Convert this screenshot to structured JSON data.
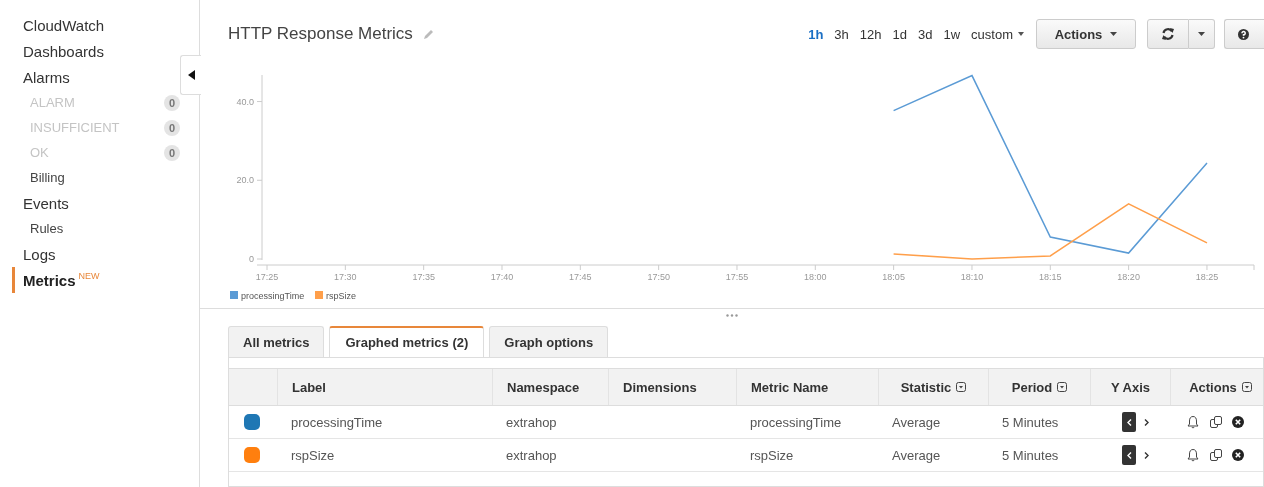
{
  "sidebar": {
    "items": [
      {
        "label": "CloudWatch",
        "selected": false
      },
      {
        "label": "Dashboards",
        "selected": false
      },
      {
        "label": "Alarms",
        "selected": false,
        "children": [
          {
            "label": "ALARM",
            "disabled": true,
            "count": "0"
          },
          {
            "label": "INSUFFICIENT",
            "disabled": true,
            "count": "0"
          },
          {
            "label": "OK",
            "disabled": true,
            "count": "0"
          },
          {
            "label": "Billing",
            "disabled": false
          }
        ]
      },
      {
        "label": "Events",
        "selected": false,
        "children": [
          {
            "label": "Rules",
            "disabled": false
          }
        ]
      },
      {
        "label": "Logs",
        "selected": false
      },
      {
        "label": "Metrics",
        "selected": true,
        "badge": "NEW"
      }
    ]
  },
  "header": {
    "title": "HTTP Response Metrics",
    "ranges": [
      {
        "label": "1h",
        "selected": true
      },
      {
        "label": "3h",
        "selected": false
      },
      {
        "label": "12h",
        "selected": false
      },
      {
        "label": "1d",
        "selected": false
      },
      {
        "label": "3d",
        "selected": false
      },
      {
        "label": "1w",
        "selected": false
      },
      {
        "label": "custom",
        "selected": false
      }
    ],
    "actions_button": "Actions"
  },
  "chart": {
    "chart_data": {
      "type": "line",
      "x": [
        "17:25",
        "17:30",
        "17:35",
        "17:40",
        "17:45",
        "17:50",
        "17:55",
        "18:00",
        "18:05",
        "18:10",
        "18:15",
        "18:20",
        "18:25"
      ],
      "ylim": [
        0,
        47
      ],
      "legend": "bottom",
      "yticks": [
        {
          "value": 0,
          "label": "0"
        },
        {
          "value": 20,
          "label": "20.0"
        },
        {
          "value": 40,
          "label": "40.0"
        }
      ],
      "series": [
        {
          "name": "processingTime",
          "color": "#5b9bd5",
          "values": [
            null,
            null,
            null,
            null,
            null,
            null,
            null,
            null,
            37.7,
            46.6,
            5.6,
            1.5,
            24.4
          ]
        },
        {
          "name": "rspSize",
          "color": "#ff9f4a",
          "values": [
            null,
            null,
            null,
            null,
            null,
            null,
            null,
            null,
            1.3,
            0,
            0.8,
            14,
            4.1
          ]
        }
      ]
    }
  },
  "tabs": [
    {
      "label": "All metrics",
      "selected": false
    },
    {
      "label": "Graphed metrics (2)",
      "selected": true
    },
    {
      "label": "Graph options",
      "selected": false
    }
  ],
  "table": {
    "columns": [
      {
        "label": "Label",
        "kind": "plain"
      },
      {
        "label": "Namespace",
        "kind": "plain"
      },
      {
        "label": "Dimensions",
        "kind": "plain"
      },
      {
        "label": "Metric Name",
        "kind": "plain"
      },
      {
        "label": "Statistic",
        "kind": "menu"
      },
      {
        "label": "Period",
        "kind": "menu"
      },
      {
        "label": "Y Axis",
        "kind": "plain"
      },
      {
        "label": "Actions",
        "kind": "menu"
      }
    ],
    "rows": [
      {
        "color": "#1f77b4",
        "label": "processingTime",
        "namespace": "extrahop",
        "metric_name": "processingTime",
        "statistic": "Average",
        "period": "5 Minutes",
        "left_axis": true
      },
      {
        "color": "#ff7f0e",
        "label": "rspSize",
        "namespace": "extrahop",
        "metric_name": "rspSize",
        "statistic": "Average",
        "period": "5 Minutes",
        "left_axis": true
      }
    ]
  }
}
